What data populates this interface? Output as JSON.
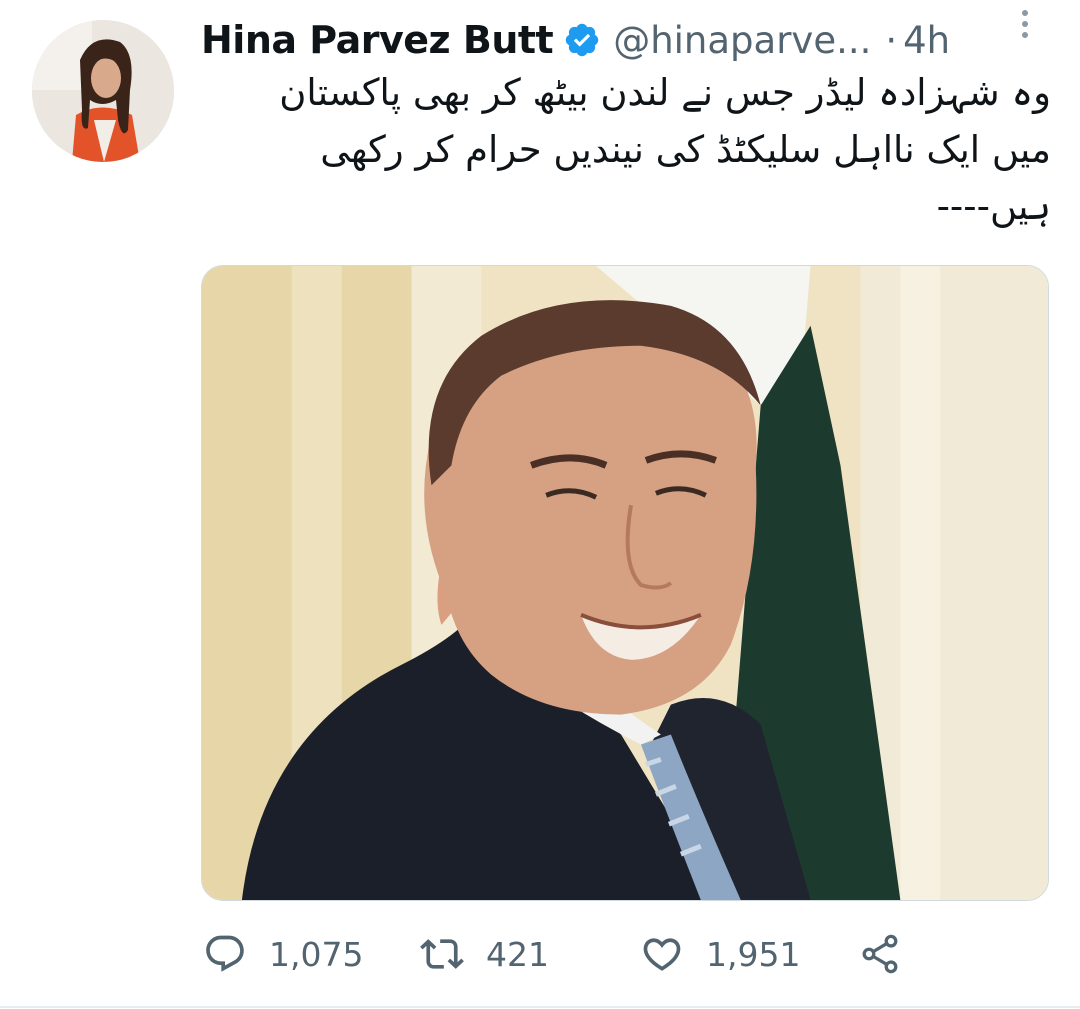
{
  "tweet": {
    "author": {
      "display_name": "Hina Parvez Butt",
      "handle": "@hinaparve...",
      "verified": true,
      "avatar_icon": "profile-photo"
    },
    "separator": "·",
    "time": "4h",
    "text_lines": [
      "وہ شہزادہ لیڈر جس نے لندن بیٹھ کر بھی پاکستان",
      "میں ایک نااہل سلیکٹڈ کی نیندیں حرام کر رکھی",
      "ہیں----"
    ],
    "media": {
      "type": "photo"
    }
  },
  "actions": {
    "reply": {
      "icon": "reply-icon",
      "count": "1,075"
    },
    "retweet": {
      "icon": "retweet-icon",
      "count": "421"
    },
    "like": {
      "icon": "like-icon",
      "count": "1,951"
    },
    "share": {
      "icon": "share-icon"
    }
  },
  "colors": {
    "text": "#0f1419",
    "secondary": "#536471",
    "verified": "#1d9bf0",
    "divider": "#e6ecf0"
  }
}
